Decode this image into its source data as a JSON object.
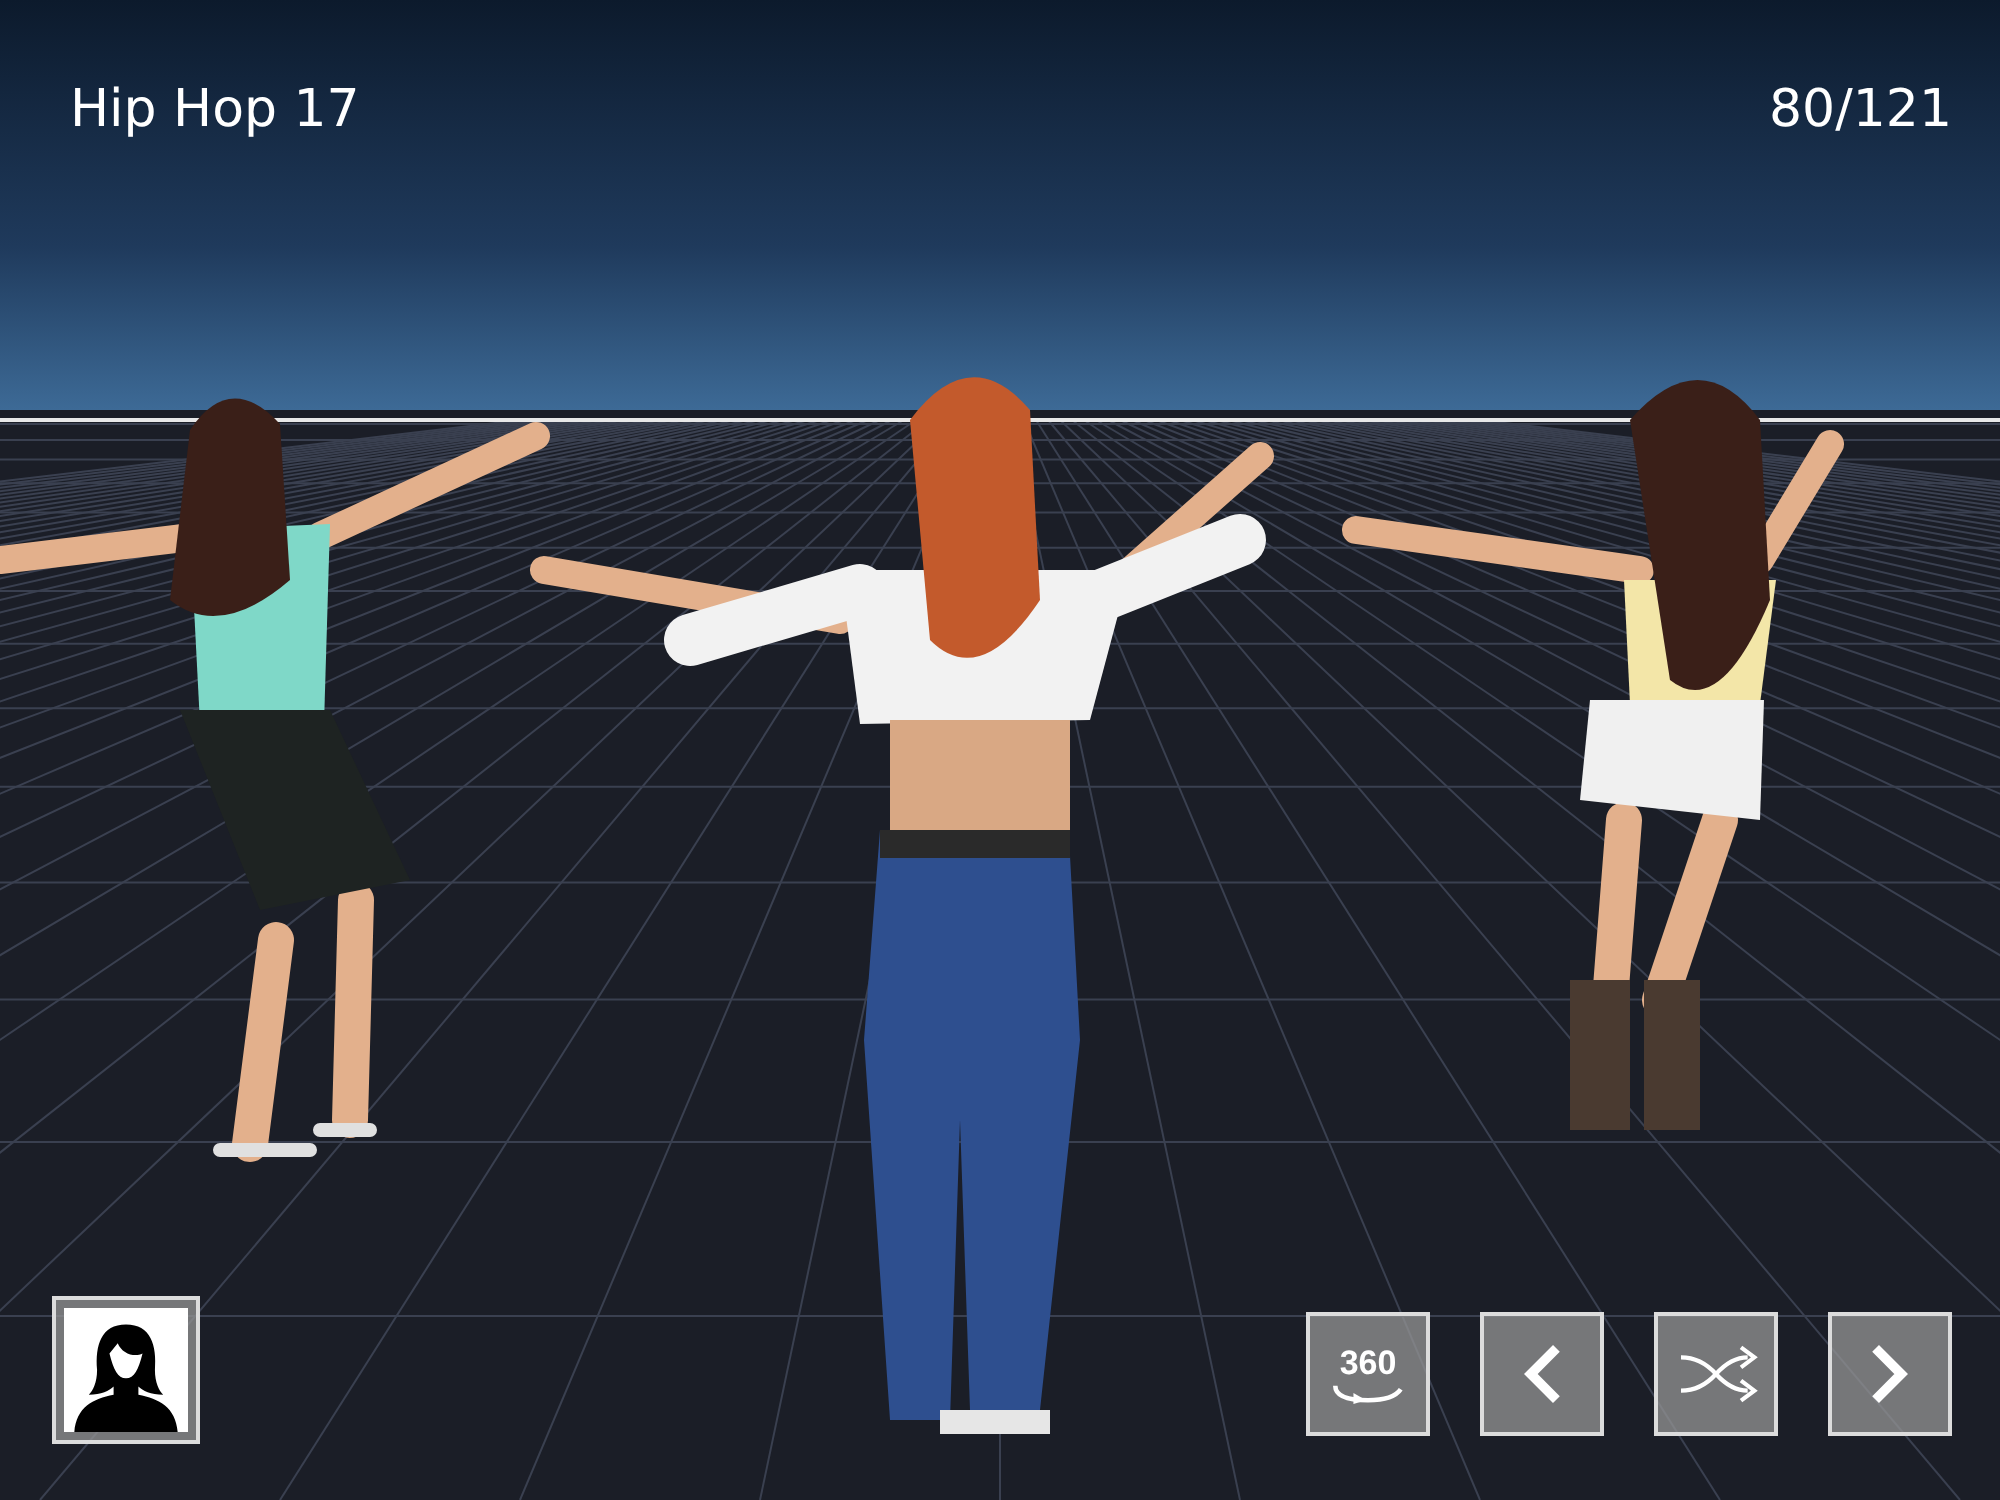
{
  "title": "Hip Hop 17",
  "counter": "80/121",
  "left_buttons": [
    {
      "kind": "avatar"
    }
  ],
  "right_buttons": [
    {
      "kind": "rotate",
      "label": "360"
    },
    {
      "kind": "previous"
    },
    {
      "kind": "shuffle"
    },
    {
      "kind": "next"
    }
  ]
}
